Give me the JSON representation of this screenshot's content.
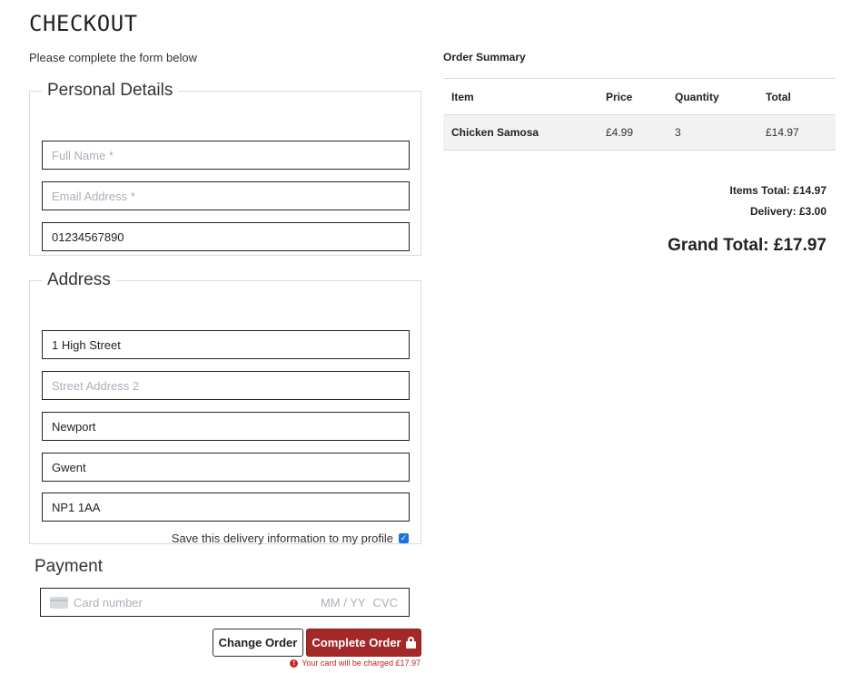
{
  "header": {
    "title": "CHECKOUT",
    "subtitle": "Please complete the form below"
  },
  "personal": {
    "legend": "Personal Details",
    "full_name": {
      "value": "",
      "placeholder": "Full Name *"
    },
    "email": {
      "value": "",
      "placeholder": "Email Address *"
    },
    "phone": {
      "value": "01234567890",
      "placeholder": ""
    }
  },
  "address": {
    "legend": "Address",
    "line1": {
      "value": "1 High Street",
      "placeholder": ""
    },
    "line2": {
      "value": "",
      "placeholder": "Street Address 2"
    },
    "town": {
      "value": "Newport",
      "placeholder": ""
    },
    "county": {
      "value": "Gwent",
      "placeholder": ""
    },
    "postcode": {
      "value": "NP1 1AA",
      "placeholder": ""
    },
    "save_label": "Save this delivery information to my profile",
    "save_checked": true
  },
  "payment": {
    "title": "Payment",
    "card_placeholder": "Card number",
    "expiry_placeholder": "MM / YY",
    "cvc_placeholder": "CVC",
    "change_order_label": "Change Order",
    "complete_order_label": "Complete Order",
    "charge_note": "Your card will be charged £17.97"
  },
  "summary": {
    "title": "Order Summary",
    "columns": [
      "Item",
      "Price",
      "Quantity",
      "Total"
    ],
    "rows": [
      {
        "item": "Chicken Samosa",
        "price": "£4.99",
        "quantity": "3",
        "total": "£14.97"
      }
    ],
    "items_total": "Items Total: £14.97",
    "delivery": "Delivery: £3.00",
    "grand_total": "Grand Total: £17.97"
  },
  "colors": {
    "accent_button": "#a32929",
    "checkbox": "#1a73e8",
    "warning": "#c62828"
  }
}
